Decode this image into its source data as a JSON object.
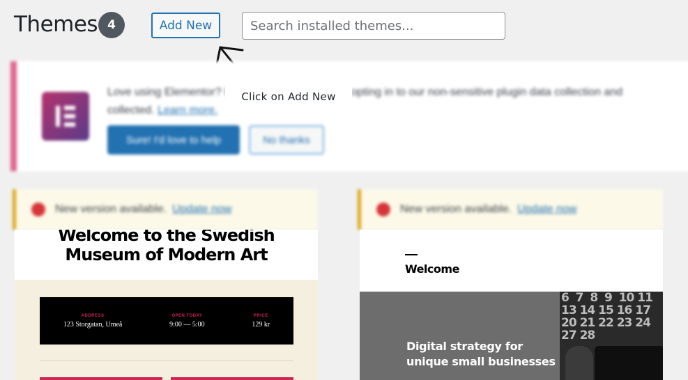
{
  "header": {
    "title": "Themes",
    "count": "4",
    "add_new_label": "Add New",
    "search_placeholder": "Search installed themes..."
  },
  "callout": {
    "text": "Click on Add New"
  },
  "notice": {
    "text_line1": "Love using Elementor? Help us make it better by opting in to our non-sensitive plugin data collection and",
    "text_line2": "collected.",
    "learn_more": "Learn more.",
    "primary_button": "Sure! I'd love to help",
    "secondary_button": "No thanks"
  },
  "updates": [
    {
      "text": "New version available.",
      "link": "Update now"
    },
    {
      "text": "New version available.",
      "link": "Update now"
    }
  ],
  "theme_cards": [
    {
      "headline_line1": "Welcome to the Swedish",
      "headline_line2": "Museum of Modern Art",
      "info": [
        {
          "label": "ADDRESS",
          "value": "123 Storgatan, Umeå"
        },
        {
          "label": "OPEN TODAY",
          "value": "9:00 — 5:00"
        },
        {
          "label": "PRICE",
          "value": "129 kr"
        }
      ]
    },
    {
      "heading": "Welcome",
      "hero_line1": "Digital strategy for",
      "hero_line2": "unique small businesses",
      "calendar_numbers": "6  7  8  9  10 11\n13 14 15 16 17\n20 21 22 23 24\n27 28"
    }
  ],
  "colors": {
    "accent": "#2271b1",
    "notice_border": "#e0698f",
    "update_border": "#dba617",
    "museum_red": "#cd2653"
  }
}
